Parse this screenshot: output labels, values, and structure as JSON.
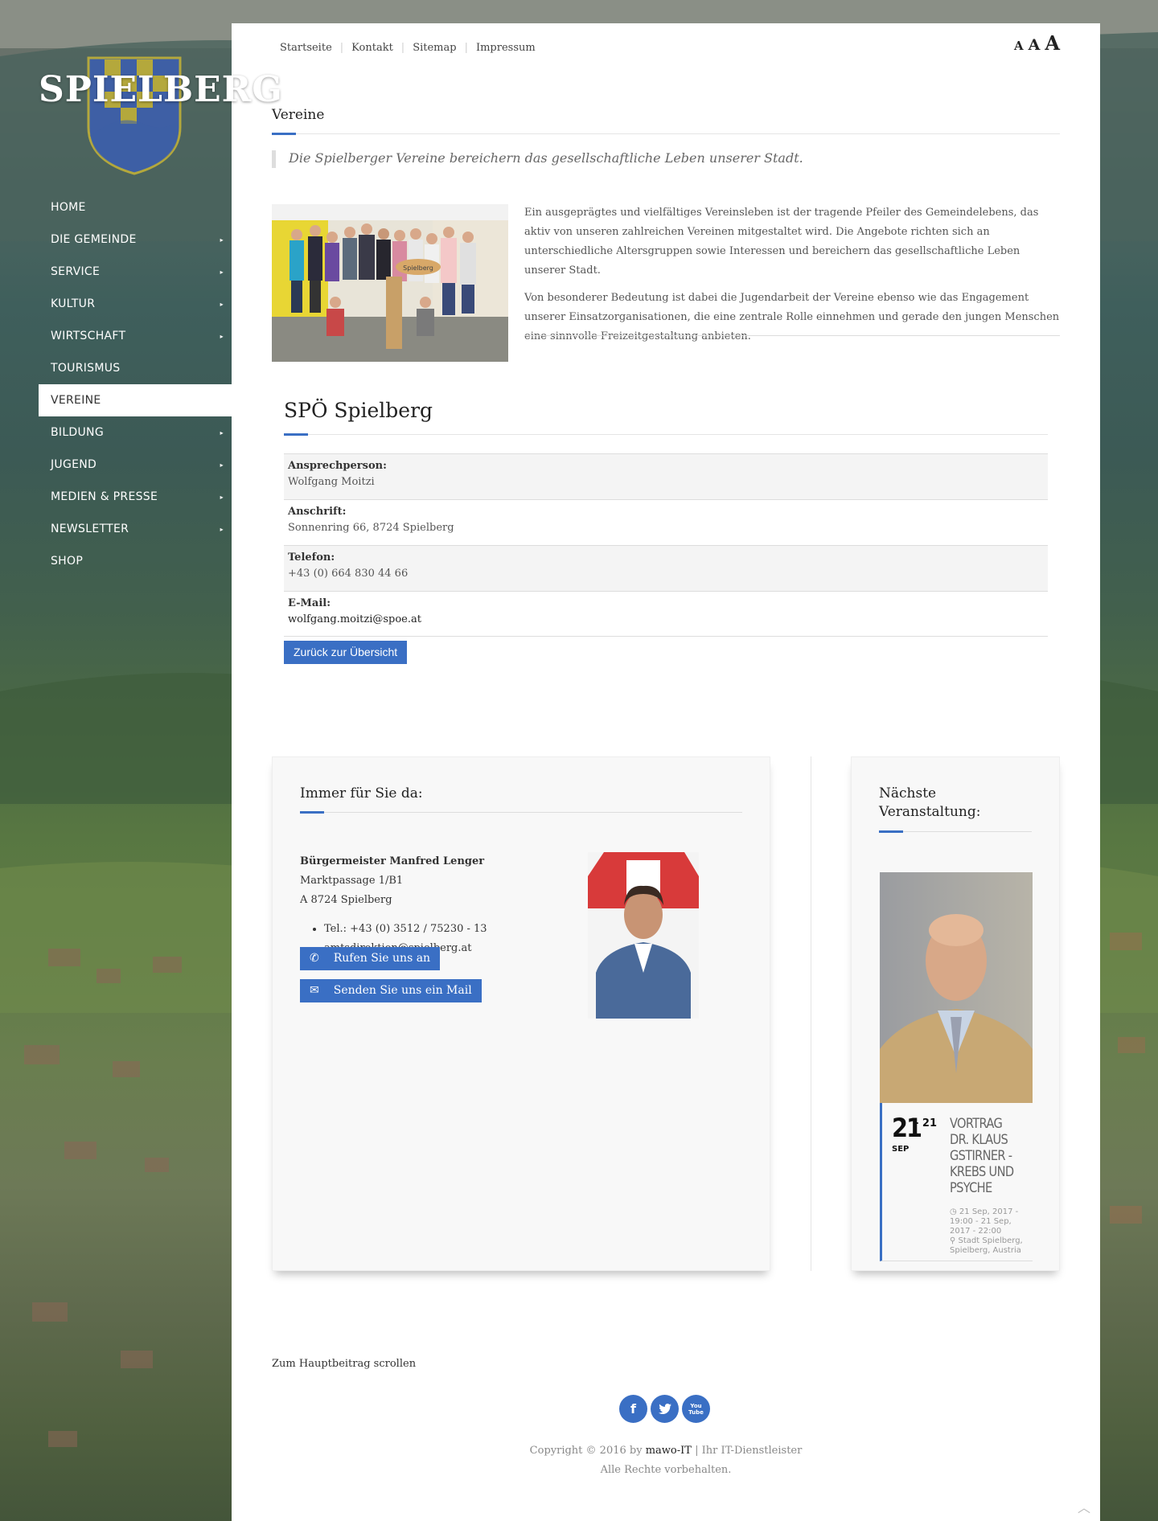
{
  "logo": {
    "text": "SPIELBERG"
  },
  "nav": {
    "items": [
      {
        "label": "HOME",
        "has_sub": false,
        "active": false
      },
      {
        "label": "DIE GEMEINDE",
        "has_sub": true,
        "active": false
      },
      {
        "label": "SERVICE",
        "has_sub": true,
        "active": false
      },
      {
        "label": "KULTUR",
        "has_sub": true,
        "active": false
      },
      {
        "label": "WIRTSCHAFT",
        "has_sub": true,
        "active": false
      },
      {
        "label": "TOURISMUS",
        "has_sub": false,
        "active": false
      },
      {
        "label": "VEREINE",
        "has_sub": false,
        "active": true
      },
      {
        "label": "BILDUNG",
        "has_sub": true,
        "active": false
      },
      {
        "label": "JUGEND",
        "has_sub": true,
        "active": false
      },
      {
        "label": "MEDIEN & PRESSE",
        "has_sub": true,
        "active": false
      },
      {
        "label": "NEWSLETTER",
        "has_sub": true,
        "active": false
      },
      {
        "label": "SHOP",
        "has_sub": false,
        "active": false
      }
    ],
    "arrow": "▸"
  },
  "topnav": {
    "links": [
      "Startseite",
      "Kontakt",
      "Sitemap",
      "Impressum"
    ]
  },
  "fontsize": {
    "small": "A",
    "medium": "A",
    "large": "A"
  },
  "page": {
    "title": "Vereine",
    "quote": "Die Spielberger Vereine bereichern das gesellschaftliche Leben unserer Stadt.",
    "intro_p1": "Ein ausgeprägtes und vielfältiges Vereinsleben ist der tragende Pfeiler des Gemeindelebens, das aktiv von unseren zahlreichen Vereinen mitgestaltet wird. Die Angebote richten sich an unterschiedliche Altersgruppen sowie Interessen und bereichern das gesellschaftliche Leben unserer Stadt.",
    "intro_p2": "Von besonderer Bedeutung ist dabei die Jugendarbeit der Vereine ebenso wie das Engagement unserer Einsatzorganisationen, die eine zentrale Rolle einnehmen und gerade den jungen Menschen eine sinnvolle Freizeitgestaltung anbieten.",
    "sign_text": "Spielberg"
  },
  "club": {
    "title": "SPÖ Spielberg",
    "rows": [
      {
        "label": "Ansprechperson:",
        "value": "Wolfgang Moitzi"
      },
      {
        "label": "Anschrift:",
        "value": "Sonnenring 66, 8724 Spielberg"
      },
      {
        "label": "Telefon:",
        "value": "+43 (0) 664 830 44 66"
      },
      {
        "label": "E-Mail:",
        "value": "wolfgang.moitzi@spoe.at"
      }
    ],
    "back_label": "Zurück zur Übersicht"
  },
  "contact": {
    "title": "Immer für Sie da:",
    "name": "Bürgermeister Manfred Lenger",
    "street": "Marktpassage 1/B1",
    "city": "A 8724 Spielberg",
    "phone": "Tel.: +43 (0) 3512 / 75230 - 13",
    "email": "amtsdirektion@spielberg.at",
    "call_label": "Rufen Sie uns an",
    "mail_label": "Senden Sie uns ein Mail"
  },
  "event": {
    "title_line1": "Nächste",
    "title_line2": "Veranstaltung:",
    "day": "21",
    "to_day": "- 21",
    "month": "SEP",
    "name": "VORTRAG DR. KLAUS GSTIRNER - KREBS UND PSYCHE",
    "time": "21 Sep, 2017 - 19:00 - 21 Sep, 2017 - 22:00",
    "location": "Stadt Spielberg, Spielberg, Austria"
  },
  "footer": {
    "scroll_label": "Zum Hauptbeitrag scrollen",
    "social": [
      "f",
      "t",
      "You Tube"
    ],
    "copy_prefix": "Copyright © 2016 by",
    "copy_brand": "mawo-IT",
    "copy_suffix": "| Ihr IT-Dienstleister",
    "rights": "Alle Rechte vorbehalten."
  },
  "colors": {
    "accent": "#3a6fc4",
    "crest_blue": "#3e5fa5",
    "crest_gold": "#b4a83c"
  }
}
